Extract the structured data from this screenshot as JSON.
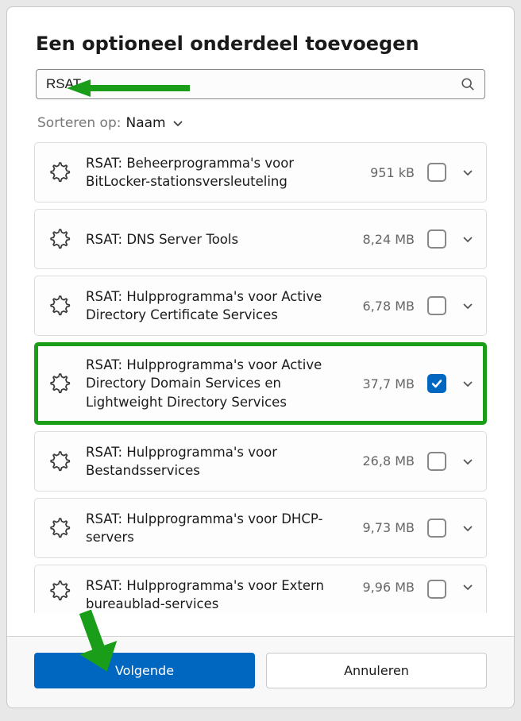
{
  "dialog": {
    "title": "Een optioneel onderdeel toevoegen"
  },
  "search": {
    "value": "RSAT"
  },
  "sort": {
    "label": "Sorteren op:",
    "value": "Naam"
  },
  "features": [
    {
      "name": "RSAT: Beheerprogramma's voor BitLocker-stationsversleuteling",
      "size": "951 kB",
      "checked": false,
      "highlighted": false
    },
    {
      "name": "RSAT: DNS Server Tools",
      "size": "8,24 MB",
      "checked": false,
      "highlighted": false
    },
    {
      "name": "RSAT: Hulpprogramma's voor Active Directory Certificate Services",
      "size": "6,78 MB",
      "checked": false,
      "highlighted": false
    },
    {
      "name": "RSAT: Hulpprogramma's voor Active Directory Domain Services en Lightweight Directory Services",
      "size": "37,7 MB",
      "checked": true,
      "highlighted": true
    },
    {
      "name": "RSAT: Hulpprogramma's voor Bestandsservices",
      "size": "26,8 MB",
      "checked": false,
      "highlighted": false
    },
    {
      "name": "RSAT: Hulpprogramma's voor DHCP-servers",
      "size": "9,73 MB",
      "checked": false,
      "highlighted": false
    },
    {
      "name": "RSAT: Hulpprogramma's voor Extern bureaublad-services",
      "size": "9,96 MB",
      "checked": false,
      "highlighted": false,
      "cut": true
    }
  ],
  "footer": {
    "primary": "Volgende",
    "secondary": "Annuleren"
  }
}
